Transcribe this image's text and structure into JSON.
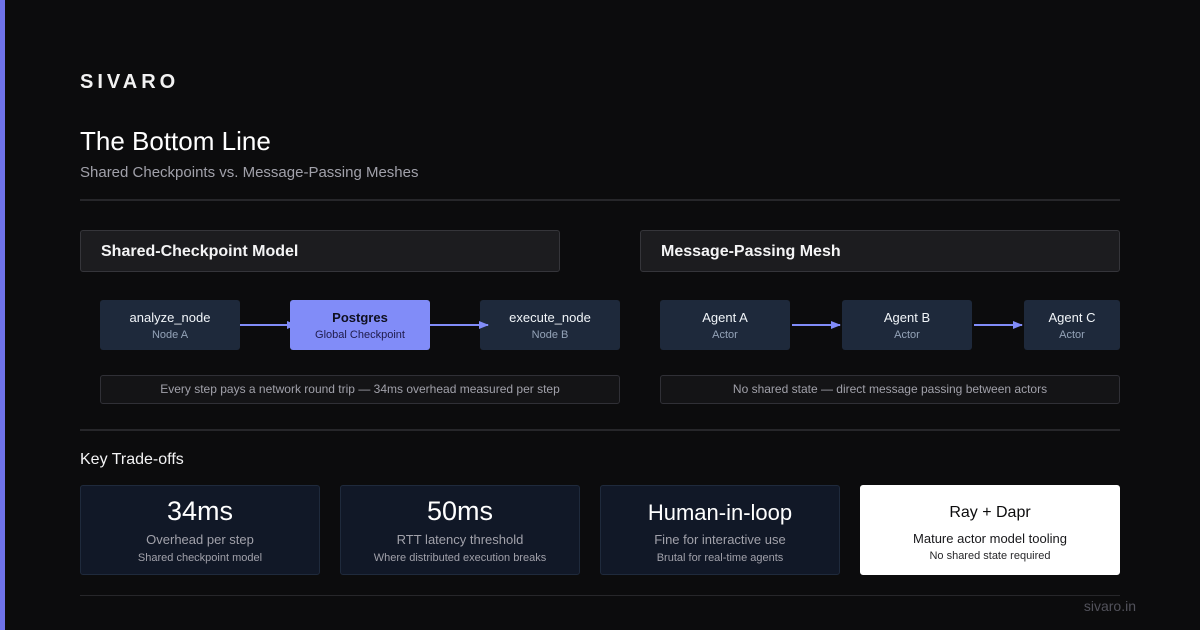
{
  "brand": "SIVARO",
  "title": "The Bottom Line",
  "subtitle": "Shared Checkpoints vs. Message-Passing Meshes",
  "left_panel": {
    "header": "Shared-Checkpoint Model",
    "nodes": [
      {
        "title": "analyze_node",
        "sub": "Node A"
      },
      {
        "title": "Postgres",
        "sub": "Global Checkpoint"
      },
      {
        "title": "execute_node",
        "sub": "Node B"
      }
    ],
    "note": "Every step pays a network round trip — 34ms overhead measured per step"
  },
  "right_panel": {
    "header": "Message-Passing Mesh",
    "nodes": [
      {
        "title": "Agent A",
        "sub": "Actor"
      },
      {
        "title": "Agent B",
        "sub": "Actor"
      },
      {
        "title": "Agent C",
        "sub": "Actor"
      }
    ],
    "note": "No shared state — direct message passing between actors"
  },
  "tradeoffs": {
    "label": "Key Trade-offs",
    "cards": [
      {
        "value": "34ms",
        "label": "Overhead per step",
        "note": "Shared checkpoint model"
      },
      {
        "value": "50ms",
        "label": "RTT latency threshold",
        "note": "Where distributed execution breaks"
      },
      {
        "value": "Human-in-loop",
        "label": "Fine for interactive use",
        "note": "Brutal for real-time agents"
      },
      {
        "value": "Ray + Dapr",
        "label": "Mature actor model tooling",
        "note": "No shared state required"
      }
    ]
  },
  "footer": "sivaro.in",
  "colors": {
    "accent": "#818cf8",
    "background": "#0c0c0d",
    "node": "#1e293b",
    "card": "#111827"
  }
}
